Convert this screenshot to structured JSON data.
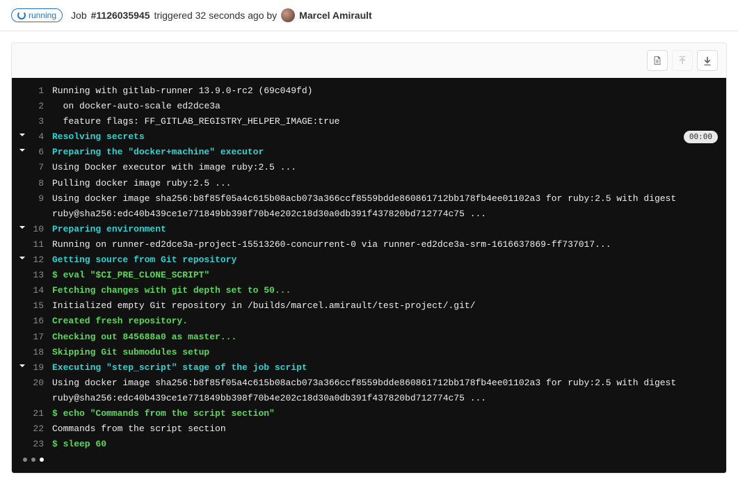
{
  "status": {
    "label": "running"
  },
  "header": {
    "job_prefix": "Job",
    "job_id": "#1126035945",
    "triggered_text": "triggered 32 seconds ago by",
    "username": "Marcel Amirault"
  },
  "toolbar": {
    "raw_title": "Show complete raw log",
    "scroll_top_title": "Scroll to top",
    "scroll_bottom_title": "Scroll to bottom"
  },
  "log": {
    "lines": [
      {
        "n": 1,
        "collapsible": false,
        "type": "plain",
        "text": "Running with gitlab-runner 13.9.0-rc2 (69c049fd)"
      },
      {
        "n": 2,
        "collapsible": false,
        "type": "plain",
        "text": "  on docker-auto-scale ed2dce3a"
      },
      {
        "n": 3,
        "collapsible": false,
        "type": "plain",
        "text": "  feature flags: FF_GITLAB_REGISTRY_HELPER_IMAGE:true"
      },
      {
        "n": 4,
        "collapsible": true,
        "type": "section",
        "text": "Resolving secrets",
        "time": "00:00"
      },
      {
        "n": 6,
        "collapsible": true,
        "type": "section",
        "text": "Preparing the \"docker+machine\" executor"
      },
      {
        "n": 7,
        "collapsible": false,
        "type": "plain",
        "text": "Using Docker executor with image ruby:2.5 ..."
      },
      {
        "n": 8,
        "collapsible": false,
        "type": "plain",
        "text": "Pulling docker image ruby:2.5 ..."
      },
      {
        "n": 9,
        "collapsible": false,
        "type": "plain",
        "text": "Using docker image sha256:b8f85f05a4c615b08acb073a366ccf8559bdde860861712bb178fb4ee01102a3 for ruby:2.5 with digest ruby@sha256:edc40b439ce1e771849bb398f70b4e202c18d30a0db391f437820bd712774c75 ..."
      },
      {
        "n": 10,
        "collapsible": true,
        "type": "section",
        "text": "Preparing environment"
      },
      {
        "n": 11,
        "collapsible": false,
        "type": "plain",
        "text": "Running on runner-ed2dce3a-project-15513260-concurrent-0 via runner-ed2dce3a-srm-1616637869-ff737017..."
      },
      {
        "n": 12,
        "collapsible": true,
        "type": "section",
        "text": "Getting source from Git repository"
      },
      {
        "n": 13,
        "collapsible": false,
        "type": "cmd",
        "text": "$ eval \"$CI_PRE_CLONE_SCRIPT\""
      },
      {
        "n": 14,
        "collapsible": false,
        "type": "green",
        "text": "Fetching changes with git depth set to 50..."
      },
      {
        "n": 15,
        "collapsible": false,
        "type": "plain",
        "text": "Initialized empty Git repository in /builds/marcel.amirault/test-project/.git/"
      },
      {
        "n": 16,
        "collapsible": false,
        "type": "green",
        "text": "Created fresh repository."
      },
      {
        "n": 17,
        "collapsible": false,
        "type": "green",
        "text": "Checking out 845688a0 as master..."
      },
      {
        "n": 18,
        "collapsible": false,
        "type": "green",
        "text": "Skipping Git submodules setup"
      },
      {
        "n": 19,
        "collapsible": true,
        "type": "section",
        "text": "Executing \"step_script\" stage of the job script"
      },
      {
        "n": 20,
        "collapsible": false,
        "type": "plain",
        "text": "Using docker image sha256:b8f85f05a4c615b08acb073a366ccf8559bdde860861712bb178fb4ee01102a3 for ruby:2.5 with digest ruby@sha256:edc40b439ce1e771849bb398f70b4e202c18d30a0db391f437820bd712774c75 ..."
      },
      {
        "n": 21,
        "collapsible": false,
        "type": "cmd",
        "text": "$ echo \"Commands from the script section\""
      },
      {
        "n": 22,
        "collapsible": false,
        "type": "plain",
        "text": "Commands from the script section"
      },
      {
        "n": 23,
        "collapsible": false,
        "type": "cmd",
        "text": "$ sleep 60"
      }
    ]
  }
}
